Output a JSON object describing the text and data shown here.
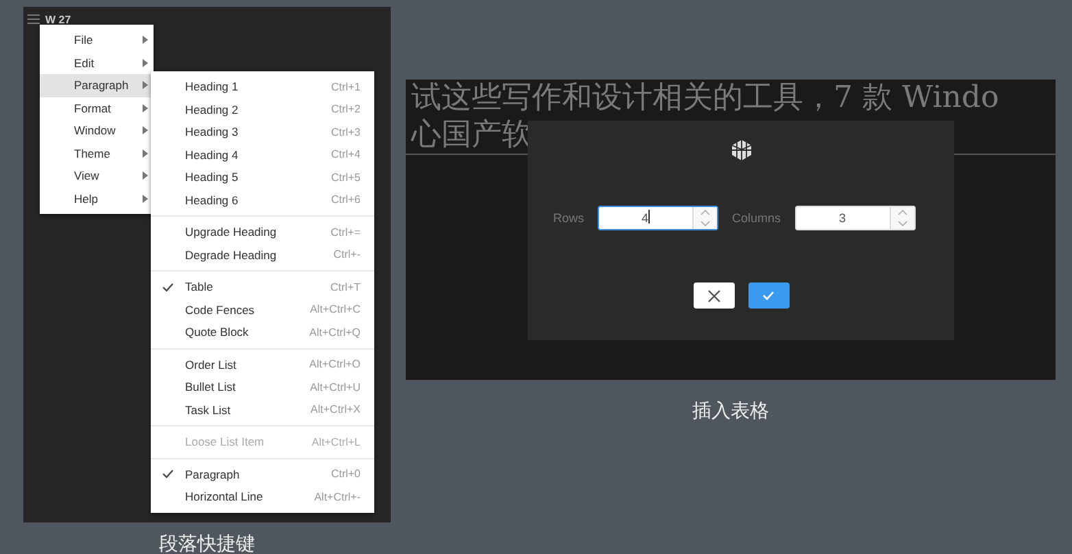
{
  "left_panel": {
    "title": "W 27",
    "menu": [
      {
        "label": "File",
        "selected": false
      },
      {
        "label": "Edit",
        "selected": false
      },
      {
        "label": "Paragraph",
        "selected": true
      },
      {
        "label": "Format",
        "selected": false
      },
      {
        "label": "Window",
        "selected": false
      },
      {
        "label": "Theme",
        "selected": false
      },
      {
        "label": "View",
        "selected": false
      },
      {
        "label": "Help",
        "selected": false
      }
    ],
    "submenu": [
      [
        {
          "label": "Heading 1",
          "shortcut": "Ctrl+1",
          "checked": false,
          "disabled": false
        },
        {
          "label": "Heading 2",
          "shortcut": "Ctrl+2",
          "checked": false,
          "disabled": false
        },
        {
          "label": "Heading 3",
          "shortcut": "Ctrl+3",
          "checked": false,
          "disabled": false
        },
        {
          "label": "Heading 4",
          "shortcut": "Ctrl+4",
          "checked": false,
          "disabled": false
        },
        {
          "label": "Heading 5",
          "shortcut": "Ctrl+5",
          "checked": false,
          "disabled": false
        },
        {
          "label": "Heading 6",
          "shortcut": "Ctrl+6",
          "checked": false,
          "disabled": false
        }
      ],
      [
        {
          "label": "Upgrade Heading",
          "shortcut": "Ctrl+=",
          "checked": false,
          "disabled": false
        },
        {
          "label": "Degrade Heading",
          "shortcut": "Ctrl+-",
          "checked": false,
          "disabled": false
        }
      ],
      [
        {
          "label": "Table",
          "shortcut": "Ctrl+T",
          "checked": true,
          "disabled": false
        },
        {
          "label": "Code Fences",
          "shortcut": "Alt+Ctrl+C",
          "checked": false,
          "disabled": false
        },
        {
          "label": "Quote Block",
          "shortcut": "Alt+Ctrl+Q",
          "checked": false,
          "disabled": false
        }
      ],
      [
        {
          "label": "Order List",
          "shortcut": "Alt+Ctrl+O",
          "checked": false,
          "disabled": false
        },
        {
          "label": "Bullet List",
          "shortcut": "Alt+Ctrl+U",
          "checked": false,
          "disabled": false
        },
        {
          "label": "Task List",
          "shortcut": "Alt+Ctrl+X",
          "checked": false,
          "disabled": false
        }
      ],
      [
        {
          "label": "Loose List Item",
          "shortcut": "Alt+Ctrl+L",
          "checked": false,
          "disabled": true
        }
      ],
      [
        {
          "label": "Paragraph",
          "shortcut": "Ctrl+0",
          "checked": true,
          "disabled": false
        },
        {
          "label": "Horizontal Line",
          "shortcut": "Alt+Ctrl+-",
          "checked": false,
          "disabled": false
        }
      ]
    ],
    "caption": "段落快捷键"
  },
  "right_panel": {
    "heading_lines": [
      "试这些写作和设计相关的工具，7 款 Windo",
      "心国产软"
    ],
    "dialog": {
      "fields": [
        {
          "label": "Rows",
          "value": "4",
          "focused": true
        },
        {
          "label": "Columns",
          "value": "3",
          "focused": false
        }
      ]
    },
    "caption": "插入表格"
  }
}
